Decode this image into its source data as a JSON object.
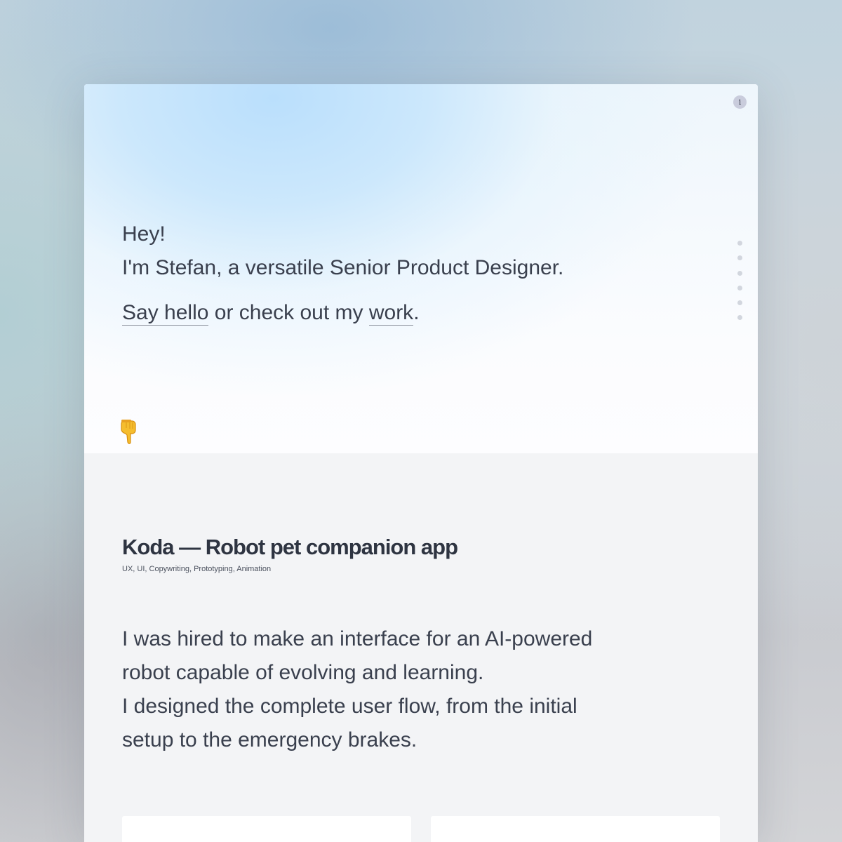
{
  "hero": {
    "greeting": "Hey!",
    "intro": "I'm Stefan, a versatile Senior Product Designer.",
    "cta": {
      "link_hello": "Say hello",
      "middle": " or check out my ",
      "link_work": "work",
      "end": "."
    },
    "info_button": "i",
    "scroll_icon": "pointing-down-hand-icon",
    "nav_dots_count": 6
  },
  "project": {
    "title": "Koda — Robot pet companion app",
    "tags": "UX, UI, Copywriting, Prototyping, Animation",
    "description": [
      "I was hired to make an interface for an AI-powered",
      "robot capable of evolving and learning.",
      "I designed the complete user flow, from the initial",
      "setup to the emergency brakes."
    ]
  },
  "colors": {
    "text": "#3a404e",
    "title": "#2e3441",
    "hero_accent": "#bfe0fb",
    "section_background": "#f3f4f6"
  }
}
